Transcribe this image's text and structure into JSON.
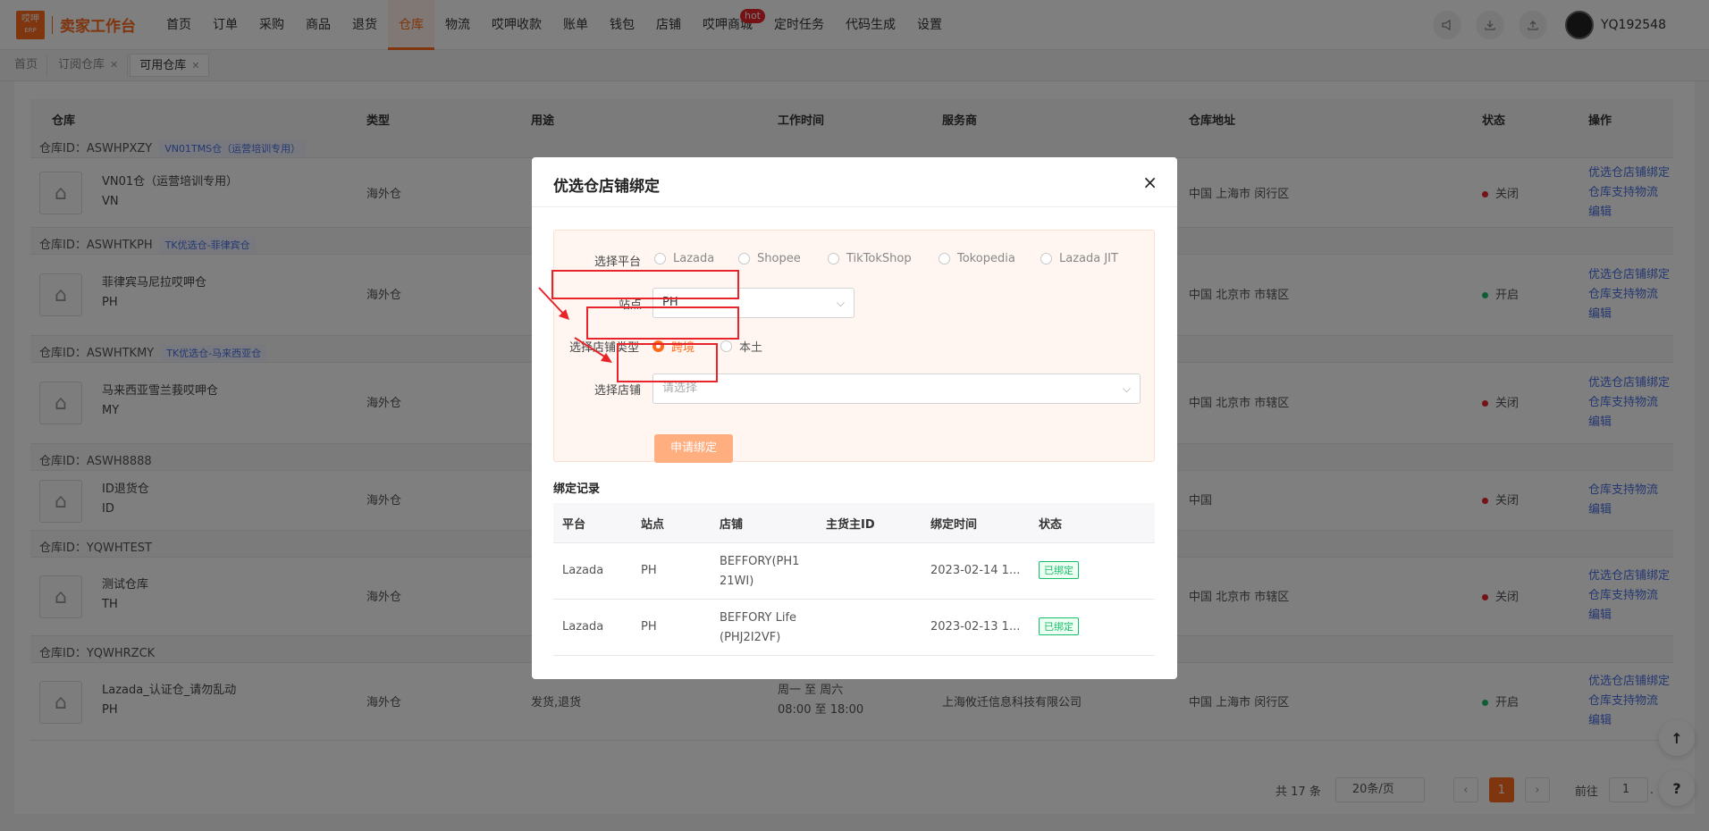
{
  "header": {
    "logo_top": "哎呷",
    "logo_bottom": "ERP",
    "app_title": "卖家工作台",
    "nav": [
      "首页",
      "订单",
      "采购",
      "商品",
      "退货",
      "仓库",
      "物流",
      "哎呷收款",
      "账单",
      "钱包",
      "店铺",
      "哎呷商城",
      "定时任务",
      "代码生成",
      "设置"
    ],
    "hot_badge": "hot",
    "username": "YQ192548"
  },
  "tabs": [
    {
      "label": "首页"
    },
    {
      "label": "订阅仓库"
    },
    {
      "label": "可用仓库"
    }
  ],
  "table": {
    "columns": [
      "仓库",
      "类型",
      "用途",
      "工作时间",
      "服务商",
      "仓库地址",
      "状态",
      "操作"
    ],
    "groups": [
      {
        "id_label": "仓库ID：ASWHPXZY",
        "tag": "VN01TMS仓（运营培训专用）",
        "name": "VN01仓（运营培训专用）",
        "code": "VN",
        "type": "海外仓",
        "address": "中国 上海市 闵行区",
        "status": "关闭",
        "ops": [
          "优选仓店铺绑定",
          "仓库支持物流",
          "编辑"
        ]
      },
      {
        "id_label": "仓库ID：ASWHTKPH",
        "tag": "TK优选仓-菲律宾仓",
        "name": "菲律宾马尼拉哎呷仓",
        "code": "PH",
        "type": "海外仓",
        "address": "中国 北京市 市辖区",
        "status": "开启",
        "ops": [
          "优选仓店铺绑定",
          "仓库支持物流",
          "编辑"
        ]
      },
      {
        "id_label": "仓库ID：ASWHTKMY",
        "tag": "TK优选仓-马来西亚仓",
        "name": "马来西亚雪兰莪哎呷仓",
        "code": "MY",
        "type": "海外仓",
        "address": "中国 北京市 市辖区",
        "status": "关闭",
        "ops": [
          "优选仓店铺绑定",
          "仓库支持物流",
          "编辑"
        ]
      },
      {
        "id_label": "仓库ID：ASWH8888",
        "tag": "",
        "name": "ID退货仓",
        "code": "ID",
        "type": "海外仓",
        "address": "中国",
        "status": "关闭",
        "ops": [
          "仓库支持物流",
          "编辑"
        ]
      },
      {
        "id_label": "仓库ID：YQWHTEST",
        "tag": "",
        "name": "测试仓库",
        "code": "TH",
        "type": "海外仓",
        "address": "中国 北京市 市辖区",
        "status": "关闭",
        "ops": [
          "优选仓店铺绑定",
          "仓库支持物流",
          "编辑"
        ]
      },
      {
        "id_label": "仓库ID：YQWHRZCK",
        "tag": "",
        "name": "Lazada_认证仓_请勿乱动",
        "code": "PH",
        "type": "海外仓",
        "usage": "发货,退货",
        "work_time_1": "周一 至 周六",
        "work_time_2": "08:00 至 18:00",
        "provider": "上海攸迁信息科技有限公司",
        "address": "中国 上海市 闵行区",
        "status": "开启",
        "ops": [
          "优选仓店铺绑定",
          "仓库支持物流",
          "编辑"
        ]
      }
    ]
  },
  "pagination": {
    "total": "共 17 条",
    "page_size": "20条/页",
    "current": "1",
    "goto": "前往",
    "goto_value": "1",
    "suffix": "."
  },
  "float": {
    "top_icon": "↑",
    "help_icon": "?"
  },
  "colors": {
    "accent": "#ff6a1a",
    "open": "#19be6b",
    "closed": "#e8242a",
    "link": "#4a6fe0"
  },
  "modal": {
    "title": "优选仓店铺绑定",
    "close": "×",
    "platform_label": "选择平台",
    "platforms": [
      "Lazada",
      "Shopee",
      "TikTokShop",
      "Tokopedia",
      "Lazada JIT"
    ],
    "site_label": "站点",
    "site_value": "PH",
    "store_type_label": "选择店铺类型",
    "store_types": [
      "跨境",
      "本土"
    ],
    "store_type_selected": "跨境",
    "store_label": "选择店铺",
    "store_placeholder": "请选择",
    "apply_button": "申请绑定",
    "records_title": "绑定记录",
    "records_columns": [
      "平台",
      "站点",
      "店铺",
      "主货主ID",
      "绑定时间",
      "状态"
    ],
    "records": [
      {
        "platform": "Lazada",
        "site": "PH",
        "store_1": "BEFFORY(PH1",
        "store_2": "21WI)",
        "owner_id": "",
        "time": "2023-02-14 1...",
        "status": "已绑定"
      },
      {
        "platform": "Lazada",
        "site": "PH",
        "store_1": "BEFFORY Life",
        "store_2": "(PHJ2I2VF)",
        "owner_id": "",
        "time": "2023-02-13 1...",
        "status": "已绑定"
      }
    ]
  }
}
